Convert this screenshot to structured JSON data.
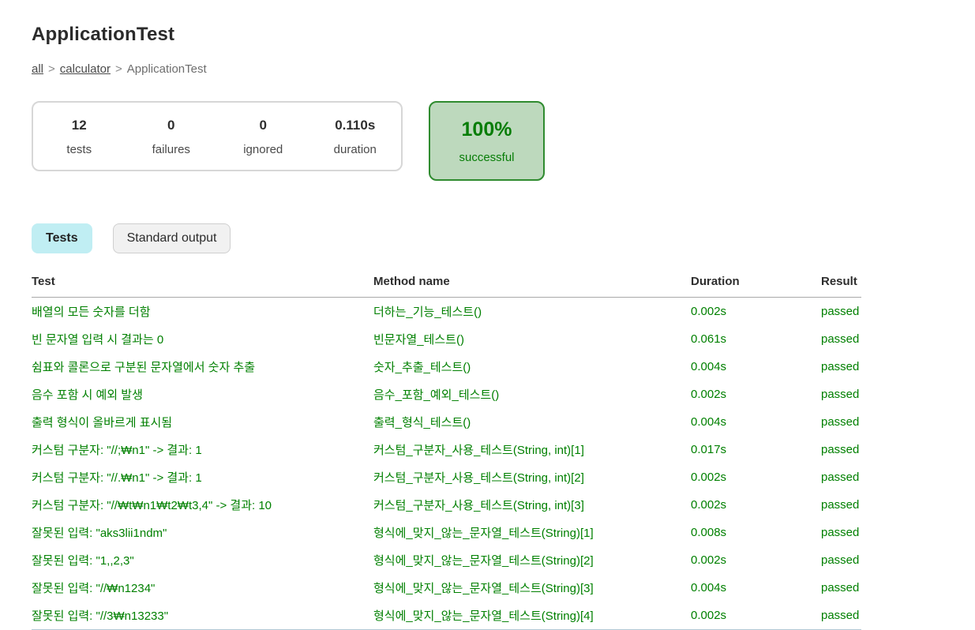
{
  "page": {
    "title": "ApplicationTest"
  },
  "breadcrumb": {
    "separator": ">",
    "items": [
      {
        "label": "all",
        "is_link": true
      },
      {
        "label": "calculator",
        "is_link": true
      },
      {
        "label": "ApplicationTest",
        "is_link": false
      }
    ]
  },
  "summary": {
    "counters": [
      {
        "value": "12",
        "label": "tests"
      },
      {
        "value": "0",
        "label": "failures"
      },
      {
        "value": "0",
        "label": "ignored"
      },
      {
        "value": "0.110s",
        "label": "duration"
      }
    ],
    "success_rate": {
      "percent": "100%",
      "label": "successful"
    }
  },
  "tabs": [
    {
      "label": "Tests",
      "selected": true
    },
    {
      "label": "Standard output",
      "selected": false
    }
  ],
  "table": {
    "headers": [
      "Test",
      "Method name",
      "Duration",
      "Result"
    ],
    "rows": [
      {
        "test": "배열의 모든 숫자를 더함",
        "method": "더하는_기능_테스트()",
        "duration": "0.002s",
        "result": "passed"
      },
      {
        "test": "빈 문자열 입력 시 결과는 0",
        "method": "빈문자열_테스트()",
        "duration": "0.061s",
        "result": "passed"
      },
      {
        "test": "쉼표와 콜론으로 구분된 문자열에서 숫자 추출",
        "method": "숫자_추출_테스트()",
        "duration": "0.004s",
        "result": "passed"
      },
      {
        "test": "음수 포함 시 예외 발생",
        "method": "음수_포함_예외_테스트()",
        "duration": "0.002s",
        "result": "passed"
      },
      {
        "test": "출력 형식이 올바르게 표시됨",
        "method": "출력_형식_테스트()",
        "duration": "0.004s",
        "result": "passed"
      },
      {
        "test": "커스텀 구분자: \"//;₩n1\" -> 결과: 1",
        "method": "커스텀_구분자_사용_테스트(String, int)[1]",
        "duration": "0.017s",
        "result": "passed"
      },
      {
        "test": "커스텀 구분자: \"//.₩n1\" -> 결과: 1",
        "method": "커스텀_구분자_사용_테스트(String, int)[2]",
        "duration": "0.002s",
        "result": "passed"
      },
      {
        "test": "커스텀 구분자: \"//₩t₩n1₩t2₩t3,4\" -> 결과: 10",
        "method": "커스텀_구분자_사용_테스트(String, int)[3]",
        "duration": "0.002s",
        "result": "passed"
      },
      {
        "test": "잘못된 입력: \"aks3lii1ndm\"",
        "method": "형식에_맞지_않는_문자열_테스트(String)[1]",
        "duration": "0.008s",
        "result": "passed"
      },
      {
        "test": "잘못된 입력: \"1,,2,3\"",
        "method": "형식에_맞지_않는_문자열_테스트(String)[2]",
        "duration": "0.002s",
        "result": "passed"
      },
      {
        "test": "잘못된 입력: \"//₩n1234\"",
        "method": "형식에_맞지_않는_문자열_테스트(String)[3]",
        "duration": "0.004s",
        "result": "passed"
      },
      {
        "test": "잘못된 입력: \"//3₩n13233\"",
        "method": "형식에_맞지_않는_문자열_테스트(String)[4]",
        "duration": "0.002s",
        "result": "passed"
      }
    ]
  },
  "colors": {
    "success_text": "#008000",
    "success_badge_bg": "#bdd9bd",
    "success_badge_border": "#2f8b2f",
    "tab_selected_bg": "#c0eef3",
    "tab_deselected_bg": "#f1f1f1",
    "summary_border": "#d7d7d7"
  }
}
